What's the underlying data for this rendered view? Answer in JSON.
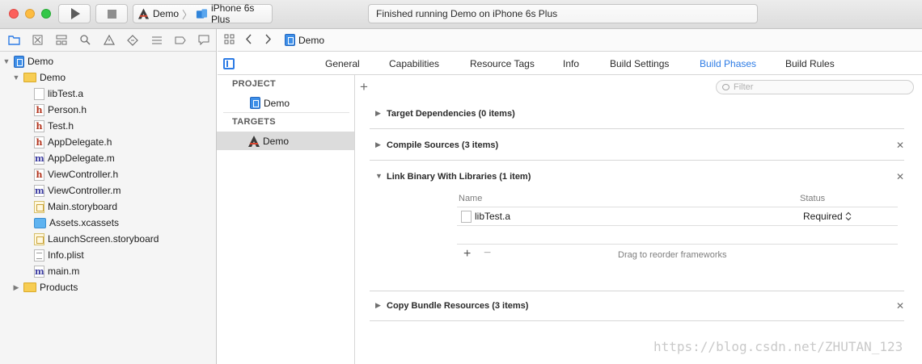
{
  "toolbar": {
    "scheme_name": "Demo",
    "device": "iPhone 6s Plus",
    "activity_status": "Finished running Demo on iPhone 6s Plus"
  },
  "navigator": {
    "tree": [
      {
        "label": "Demo",
        "icon": "project-icon",
        "depth": 0,
        "expanded": true
      },
      {
        "label": "Demo",
        "icon": "folder-icon",
        "depth": 1,
        "expanded": true
      },
      {
        "label": "libTest.a",
        "icon": "library-file-icon",
        "depth": 2
      },
      {
        "label": "Person.h",
        "icon": "header-file-icon",
        "depth": 2
      },
      {
        "label": "Test.h",
        "icon": "header-file-icon",
        "depth": 2
      },
      {
        "label": "AppDelegate.h",
        "icon": "header-file-icon",
        "depth": 2
      },
      {
        "label": "AppDelegate.m",
        "icon": "source-file-icon",
        "depth": 2
      },
      {
        "label": "ViewController.h",
        "icon": "header-file-icon",
        "depth": 2
      },
      {
        "label": "ViewController.m",
        "icon": "source-file-icon",
        "depth": 2
      },
      {
        "label": "Main.storyboard",
        "icon": "storyboard-icon",
        "depth": 2
      },
      {
        "label": "Assets.xcassets",
        "icon": "assets-icon",
        "depth": 2
      },
      {
        "label": "LaunchScreen.storyboard",
        "icon": "storyboard-icon",
        "depth": 2
      },
      {
        "label": "Info.plist",
        "icon": "plist-icon",
        "depth": 2
      },
      {
        "label": "main.m",
        "icon": "source-file-icon",
        "depth": 2
      },
      {
        "label": "Products",
        "icon": "folder-icon",
        "depth": 1,
        "expanded": false
      }
    ]
  },
  "editor": {
    "jump_file": "Demo",
    "tabs": [
      "General",
      "Capabilities",
      "Resource Tags",
      "Info",
      "Build Settings",
      "Build Phases",
      "Build Rules"
    ],
    "active_tab": "Build Phases"
  },
  "targets_list": {
    "project_header": "PROJECT",
    "project_item": "Demo",
    "targets_header": "TARGETS",
    "target_item": "Demo"
  },
  "phases": {
    "filter_placeholder": "Filter",
    "target_dependencies": "Target Dependencies (0 items)",
    "compile_sources": "Compile Sources (3 items)",
    "link_binary": "Link Binary With Libraries (1 item)",
    "copy_bundle": "Copy Bundle Resources (3 items)",
    "col_name": "Name",
    "col_status": "Status",
    "library_name": "libTest.a",
    "library_status": "Required",
    "drag_hint": "Drag to reorder frameworks"
  },
  "watermark": "https://blog.csdn.net/ZHUTAN_123"
}
